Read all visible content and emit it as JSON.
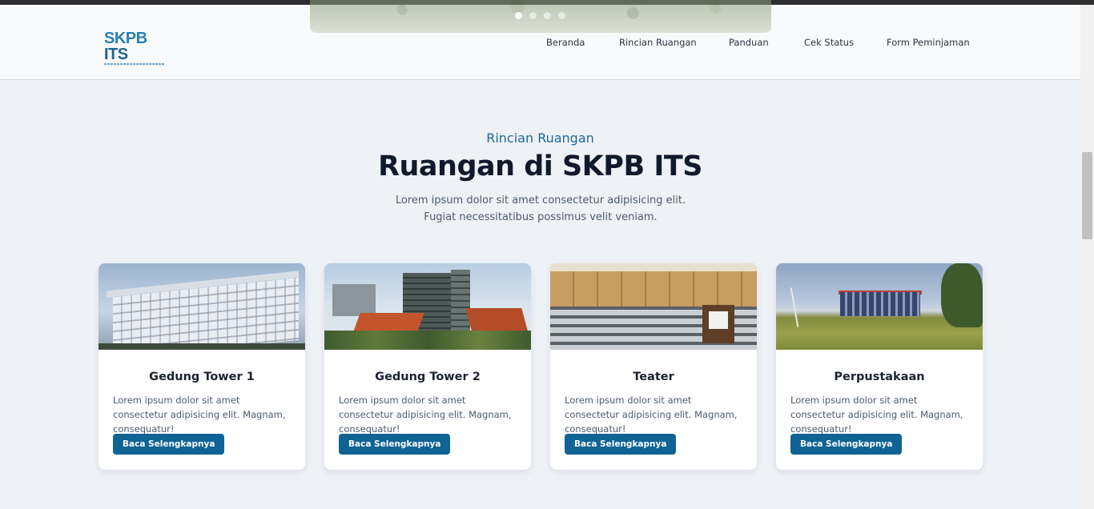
{
  "header": {
    "logo": {
      "text_main": "SKPB",
      "text_accent": "ITS"
    },
    "nav": [
      {
        "label": "Beranda"
      },
      {
        "label": "Rincian Ruangan"
      },
      {
        "label": "Panduan"
      },
      {
        "label": "Cek Status"
      },
      {
        "label": "Form Peminjaman"
      }
    ],
    "carousel": {
      "dots": 4,
      "active_index": 0
    }
  },
  "section": {
    "eyebrow": "Rincian Ruangan",
    "title": "Ruangan di SKPB ITS",
    "description": "Lorem ipsum dolor sit amet consectetur adipisicing elit. Fugiat necessitatibus possimus velit veniam."
  },
  "cards": [
    {
      "title": "Gedung Tower 1",
      "text": "Lorem ipsum dolor sit amet consectetur adipisicing elit. Magnam, consequatur!",
      "button": "Baca Selengkapnya",
      "image": "tower-building-photo"
    },
    {
      "title": "Gedung Tower 2",
      "text": "Lorem ipsum dolor sit amet consectetur adipisicing elit. Magnam, consequatur!",
      "button": "Baca Selengkapnya",
      "image": "tower-building-red-roof-photo"
    },
    {
      "title": "Teater",
      "text": "Lorem ipsum dolor sit amet consectetur adipisicing elit. Magnam, consequatur!",
      "button": "Baca Selengkapnya",
      "image": "lecture-hall-photo"
    },
    {
      "title": "Perpustakaan",
      "text": "Lorem ipsum dolor sit amet consectetur adipisicing elit. Magnam, consequatur!",
      "button": "Baca Selengkapnya",
      "image": "library-field-photo"
    }
  ],
  "colors": {
    "accent": "#0f6395",
    "eyebrow": "#1e6a96",
    "title": "#111a2c",
    "body_text": "#4d5a6c",
    "page_bg": "#eef1f6",
    "header_bg": "#f9fafc"
  }
}
